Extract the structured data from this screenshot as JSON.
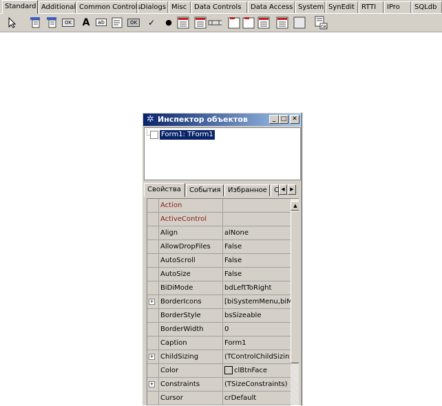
{
  "palette": {
    "tabs": [
      "Standard",
      "Additional",
      "Common Controls",
      "Dialogs",
      "Misc",
      "Data Controls",
      "Data Access",
      "System",
      "SynEdit",
      "RTTI",
      "IPro",
      "SQLdb"
    ],
    "active_tab": "Standard",
    "components": [
      "pointer",
      "TMainMenu",
      "TPopupMenu",
      "TButton",
      "TLabel",
      "TEdit",
      "TMemo",
      "TToggleBox",
      "TCheckBox",
      "TRadioButton",
      "TListBox",
      "TComboBox",
      "TScrollBar",
      "TGroupBox",
      "TRadioGroup",
      "TCheckGroup",
      "TPanel",
      "TFrame",
      "TActionList"
    ],
    "button_caption": "OK",
    "label_glyph": "A",
    "edit_glyph": "ab"
  },
  "inspector": {
    "title": "Инспектор объектов",
    "tree_item": "Form1: TForm1",
    "tabs": [
      "Свойства",
      "События",
      "Избранное",
      "С"
    ],
    "properties": [
      {
        "name": "Action",
        "value": "",
        "red": true,
        "expandable": false
      },
      {
        "name": "ActiveControl",
        "value": "",
        "red": true,
        "expandable": false
      },
      {
        "name": "Align",
        "value": "alNone",
        "red": false,
        "expandable": false
      },
      {
        "name": "AllowDropFiles",
        "value": "False",
        "red": false,
        "expandable": false
      },
      {
        "name": "AutoScroll",
        "value": "False",
        "red": false,
        "expandable": false
      },
      {
        "name": "AutoSize",
        "value": "False",
        "red": false,
        "expandable": false
      },
      {
        "name": "BiDiMode",
        "value": "bdLeftToRight",
        "red": false,
        "expandable": false
      },
      {
        "name": "BorderIcons",
        "value": "[biSystemMenu,biM",
        "red": false,
        "expandable": true
      },
      {
        "name": "BorderStyle",
        "value": "bsSizeable",
        "red": false,
        "expandable": false
      },
      {
        "name": "BorderWidth",
        "value": "0",
        "red": false,
        "expandable": false
      },
      {
        "name": "Caption",
        "value": "Form1",
        "red": false,
        "expandable": false
      },
      {
        "name": "ChildSizing",
        "value": "(TControlChildSizin",
        "red": false,
        "expandable": true
      },
      {
        "name": "Color",
        "value": "clBtnFace",
        "red": false,
        "expandable": false,
        "swatch": true
      },
      {
        "name": "Constraints",
        "value": "(TSizeConstraints)",
        "red": false,
        "expandable": true
      },
      {
        "name": "Cursor",
        "value": "crDefault",
        "red": false,
        "expandable": false
      }
    ]
  }
}
